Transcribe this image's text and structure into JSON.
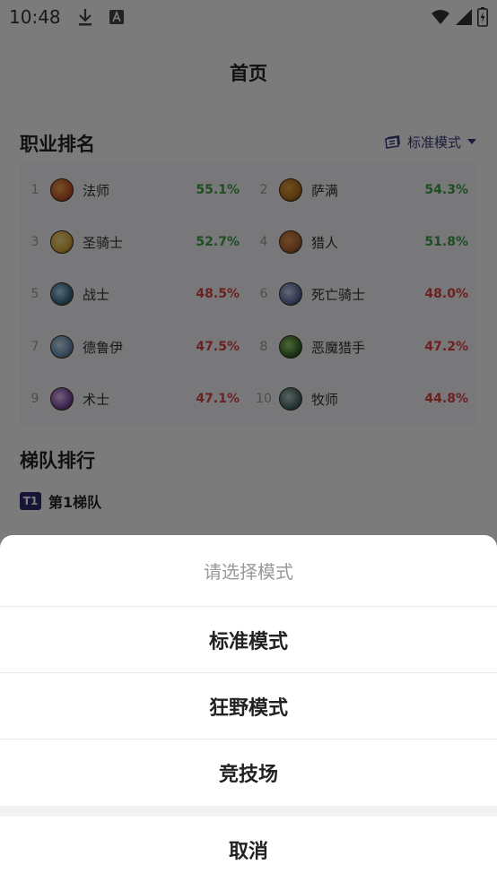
{
  "status_bar": {
    "time": "10:48",
    "icons": [
      "download-icon",
      "notification-a-icon",
      "wifi-icon",
      "signal-icon",
      "battery-charging-icon"
    ]
  },
  "header": {
    "title": "首页"
  },
  "class_ranking": {
    "title": "职业排名",
    "mode_label": "标准模式",
    "items": [
      {
        "rank": "1",
        "name": "法师",
        "winrate": "55.1%",
        "trend": "up",
        "avatar_color": "#c0542a"
      },
      {
        "rank": "2",
        "name": "萨满",
        "winrate": "54.3%",
        "trend": "up",
        "avatar_color": "#b0701c"
      },
      {
        "rank": "3",
        "name": "圣骑士",
        "winrate": "52.7%",
        "trend": "up",
        "avatar_color": "#d6a83c"
      },
      {
        "rank": "4",
        "name": "猎人",
        "winrate": "51.8%",
        "trend": "up",
        "avatar_color": "#a86430"
      },
      {
        "rank": "5",
        "name": "战士",
        "winrate": "48.5%",
        "trend": "down",
        "avatar_color": "#3f6d84"
      },
      {
        "rank": "6",
        "name": "死亡骑士",
        "winrate": "48.0%",
        "trend": "down",
        "avatar_color": "#5f6f9e"
      },
      {
        "rank": "7",
        "name": "德鲁伊",
        "winrate": "47.5%",
        "trend": "down",
        "avatar_color": "#6a8fb0"
      },
      {
        "rank": "8",
        "name": "恶魔猎手",
        "winrate": "47.2%",
        "trend": "down",
        "avatar_color": "#3b6a2e"
      },
      {
        "rank": "9",
        "name": "术士",
        "winrate": "47.1%",
        "trend": "down",
        "avatar_color": "#7a4a9a"
      },
      {
        "rank": "10",
        "name": "牧师",
        "winrate": "44.8%",
        "trend": "down",
        "avatar_color": "#4a6a6a"
      }
    ]
  },
  "tier_list": {
    "title": "梯队排行",
    "tier_badge": "T1",
    "tier_name": "第1梯队"
  },
  "mode_sheet": {
    "prompt": "请选择模式",
    "options": [
      "标准模式",
      "狂野模式",
      "竞技场"
    ],
    "cancel": "取消"
  },
  "colors": {
    "accent": "#2f2a6b",
    "positive": "#3c9a45",
    "negative": "#d84040",
    "overlay": "rgba(0,0,0,0.5)"
  }
}
